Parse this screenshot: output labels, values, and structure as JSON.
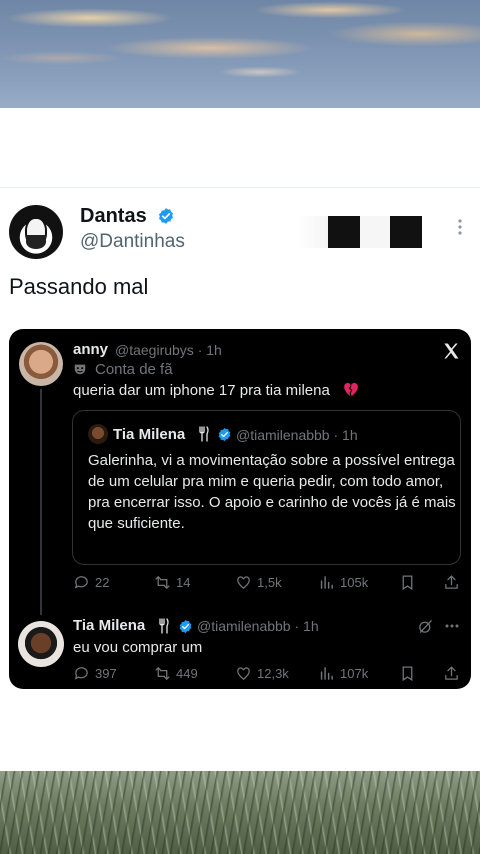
{
  "post": {
    "author_name": "Dantas",
    "author_handle": "@Dantinhas",
    "text": "Passando mal"
  },
  "embedded": {
    "reply_author": {
      "name": "anny",
      "handle_time": "@taegirubys · 1h",
      "community_label": "Conta de fã",
      "text": "queria dar um iphone 17 pra tia milena"
    },
    "quoted": {
      "name": "Tia Milena",
      "handle_time": "@tiamilenabbb · 1h",
      "text": "Galerinha, vi a movimentação sobre a possível entrega de um celular pra mim e queria pedir, com todo amor, pra encerrar isso. O apoio e carinho de vocês já é mais que suficiente."
    },
    "reply_stats": {
      "replies": "22",
      "reposts": "14",
      "likes": "1,5k",
      "views": "105k"
    },
    "second": {
      "name": "Tia Milena",
      "handle_time": "@tiamilenabbb · 1h",
      "text": "eu vou comprar um"
    },
    "second_stats": {
      "replies": "397",
      "reposts": "449",
      "likes": "12,3k",
      "views": "107k"
    }
  },
  "colors": {
    "verified": "#1d9bf0",
    "broken_heart": "#e0245e",
    "dark_bg": "#000000",
    "muted_dark": "#71767b"
  },
  "icons": {
    "logo": "x-logo-icon",
    "reply": "reply-icon",
    "repost": "repost-icon",
    "like": "heart-icon",
    "views": "views-icon",
    "bookmark": "bookmark-icon",
    "share": "share-icon"
  }
}
